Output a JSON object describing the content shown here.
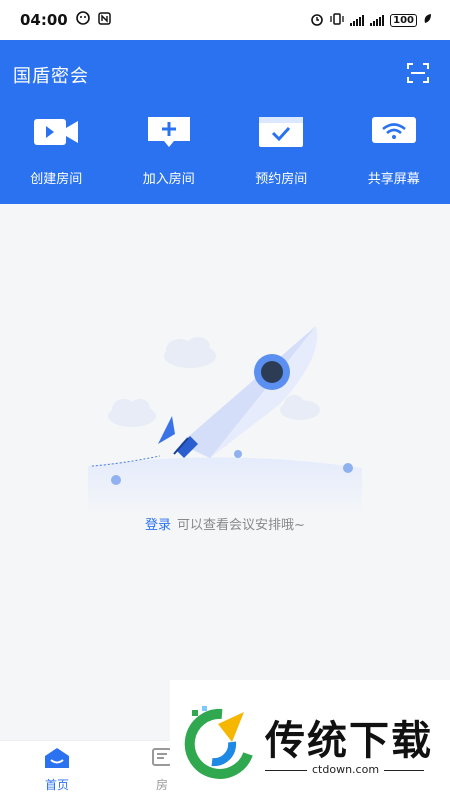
{
  "status_bar": {
    "time": "04:00",
    "battery": "100"
  },
  "header": {
    "title": "国盾密会",
    "scan_icon": "scan-icon"
  },
  "actions": [
    {
      "label": "创建房间",
      "icon": "video-camera-icon"
    },
    {
      "label": "加入房间",
      "icon": "add-message-icon"
    },
    {
      "label": "预约房间",
      "icon": "calendar-check-icon"
    },
    {
      "label": "共享屏幕",
      "icon": "screen-share-icon"
    }
  ],
  "empty_state": {
    "login_link": "登录",
    "message": "可以查看会议安排哦~",
    "illustration": "rocket-illustration"
  },
  "bottom_nav": {
    "items": [
      {
        "label": "首页",
        "icon": "home-icon",
        "active": true
      },
      {
        "label": "房",
        "icon": "room-icon",
        "active": false
      }
    ]
  },
  "watermark": {
    "title": "传统下载",
    "url": "ctdown.com"
  },
  "colors": {
    "primary": "#2b72f0",
    "background": "#f5f6f8"
  }
}
